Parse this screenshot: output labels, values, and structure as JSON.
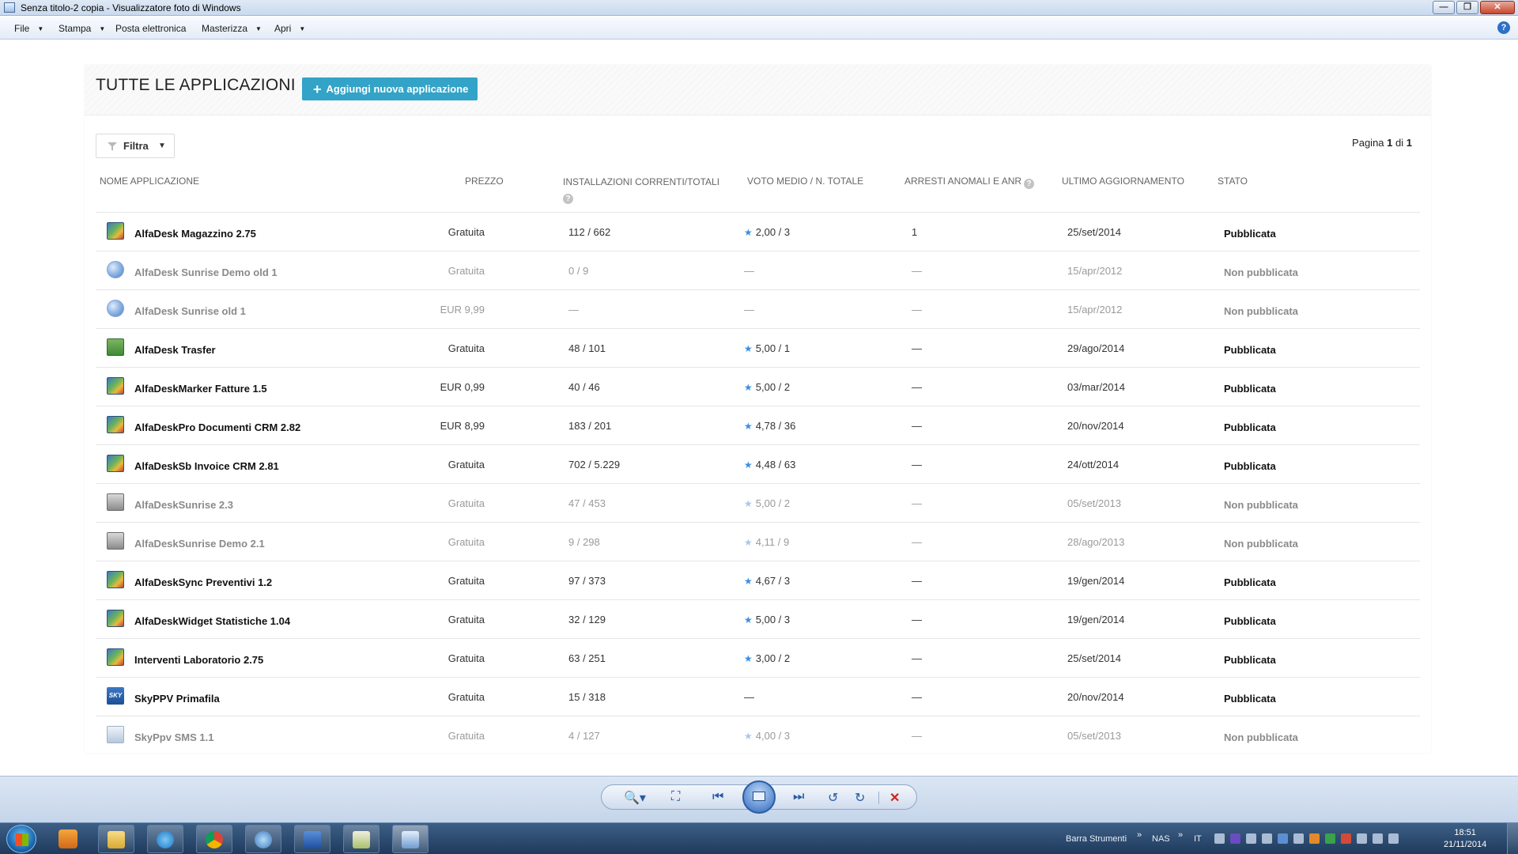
{
  "window": {
    "title": "Senza titolo-2 copia - Visualizzatore foto di Windows",
    "minimize": "—",
    "maximize": "❐",
    "close": "✕"
  },
  "menu": {
    "file": "File",
    "stampa": "Stampa",
    "posta": "Posta elettronica",
    "masterizza": "Masterizza",
    "apri": "Apri",
    "help": "?"
  },
  "page": {
    "heading": "TUTTE LE APPLICAZIONI",
    "add_button": "Aggiungi nuova applicazione",
    "filter_label": "Filtra",
    "pagination": {
      "prefix": "Pagina",
      "current": "1",
      "sep": "di",
      "total": "1"
    }
  },
  "columns": {
    "name": "NOME APPLICAZIONE",
    "price": "PREZZO",
    "installs": "INSTALLAZIONI CORRENTI/TOTALI",
    "rating": "VOTO MEDIO / N. TOTALE",
    "crashes": "ARRESTI ANOMALI E ANR",
    "updated": "ULTIMO AGGIORNAMENTO",
    "status": "STATO"
  },
  "apps": [
    {
      "icon": "multi-icon",
      "name": "AlfaDesk Magazzino 2.75",
      "price": "Gratuita",
      "installs": "112  /  662",
      "rating": "2,00  /  3",
      "star": true,
      "crashes": "1",
      "updated": "25/set/2014",
      "status": "Pubblicata",
      "published": true
    },
    {
      "icon": "globe-icon",
      "name": "AlfaDesk Sunrise Demo old 1",
      "price": "Gratuita",
      "installs": "0  /  9",
      "rating": "—",
      "star": false,
      "crashes": "—",
      "updated": "15/apr/2012",
      "status": "Non pubblicata",
      "published": false
    },
    {
      "icon": "globe-icon",
      "name": "AlfaDesk Sunrise old 1",
      "price": "EUR 9,99",
      "installs": "—",
      "rating": "—",
      "star": false,
      "crashes": "—",
      "updated": "15/apr/2012",
      "status": "Non pubblicata",
      "published": false
    },
    {
      "icon": "transfer-icon",
      "name": "AlfaDesk Trasfer",
      "price": "Gratuita",
      "installs": "48  /  101",
      "rating": "5,00  /  1",
      "star": true,
      "crashes": "—",
      "updated": "29/ago/2014",
      "status": "Pubblicata",
      "published": true
    },
    {
      "icon": "multi-icon",
      "name": "AlfaDeskMarker Fatture 1.5",
      "price": "EUR 0,99",
      "installs": "40  /  46",
      "rating": "5,00  /  2",
      "star": true,
      "crashes": "—",
      "updated": "03/mar/2014",
      "status": "Pubblicata",
      "published": true
    },
    {
      "icon": "multi-icon",
      "name": "AlfaDeskPro Documenti CRM 2.82",
      "price": "EUR 8,99",
      "installs": "183  /  201",
      "rating": "4,78  /  36",
      "star": true,
      "crashes": "—",
      "updated": "20/nov/2014",
      "status": "Pubblicata",
      "published": true
    },
    {
      "icon": "multi-icon",
      "name": "AlfaDeskSb Invoice CRM 2.81",
      "price": "Gratuita",
      "installs": "702  /  5.229",
      "rating": "4,48  /  63",
      "star": true,
      "crashes": "—",
      "updated": "24/ott/2014",
      "status": "Pubblicata",
      "published": true
    },
    {
      "icon": "grey-app-icon",
      "name": "AlfaDeskSunrise 2.3",
      "price": "Gratuita",
      "installs": "47  /  453",
      "rating": "5,00  /  2",
      "star": true,
      "crashes": "—",
      "updated": "05/set/2013",
      "status": "Non pubblicata",
      "published": false
    },
    {
      "icon": "grey-app-icon",
      "name": "AlfaDeskSunrise Demo 2.1",
      "price": "Gratuita",
      "installs": "9  /  298",
      "rating": "4,11  /  9",
      "star": true,
      "crashes": "—",
      "updated": "28/ago/2013",
      "status": "Non pubblicata",
      "published": false
    },
    {
      "icon": "multi-icon",
      "name": "AlfaDeskSync Preventivi 1.2",
      "price": "Gratuita",
      "installs": "97  /  373",
      "rating": "4,67  /  3",
      "star": true,
      "crashes": "—",
      "updated": "19/gen/2014",
      "status": "Pubblicata",
      "published": true
    },
    {
      "icon": "multi-icon",
      "name": "AlfaDeskWidget Statistiche 1.04",
      "price": "Gratuita",
      "installs": "32  /  129",
      "rating": "5,00  /  3",
      "star": true,
      "crashes": "—",
      "updated": "19/gen/2014",
      "status": "Pubblicata",
      "published": true
    },
    {
      "icon": "multi-icon",
      "name": "Interventi Laboratorio 2.75",
      "price": "Gratuita",
      "installs": "63  /  251",
      "rating": "3,00  /  2",
      "star": true,
      "crashes": "—",
      "updated": "25/set/2014",
      "status": "Pubblicata",
      "published": true
    },
    {
      "icon": "sky-icon",
      "name": "SkyPPV Primafila",
      "price": "Gratuita",
      "installs": "15  /  318",
      "rating": "—",
      "star": false,
      "crashes": "—",
      "updated": "20/nov/2014",
      "status": "Pubblicata",
      "published": true
    },
    {
      "icon": "sms-icon",
      "name": "SkyPpv SMS 1.1",
      "price": "Gratuita",
      "installs": "4  /  127",
      "rating": "4,00  /  3",
      "star": true,
      "crashes": "—",
      "updated": "05/set/2013",
      "status": "Non pubblicata",
      "published": false
    }
  ],
  "sky_icon_text": "SKY",
  "viewer_controls": {
    "zoom": "🔍▾",
    "fit": "⛶",
    "prev": "⏮",
    "next": "⏭",
    "rotate_left": "↺",
    "rotate_right": "↻",
    "delete": "✕"
  },
  "taskbar": {
    "toolbar_label": "Barra Strumenti",
    "toolbar_chevron": "»",
    "nas_label": "NAS",
    "nas_chevron": "»",
    "language": "IT",
    "time": "18:51",
    "date": "21/11/2014"
  },
  "colors": {
    "accent": "#33a3c7",
    "star": "#3b8ede",
    "taskbar": "#1f3a5c"
  }
}
